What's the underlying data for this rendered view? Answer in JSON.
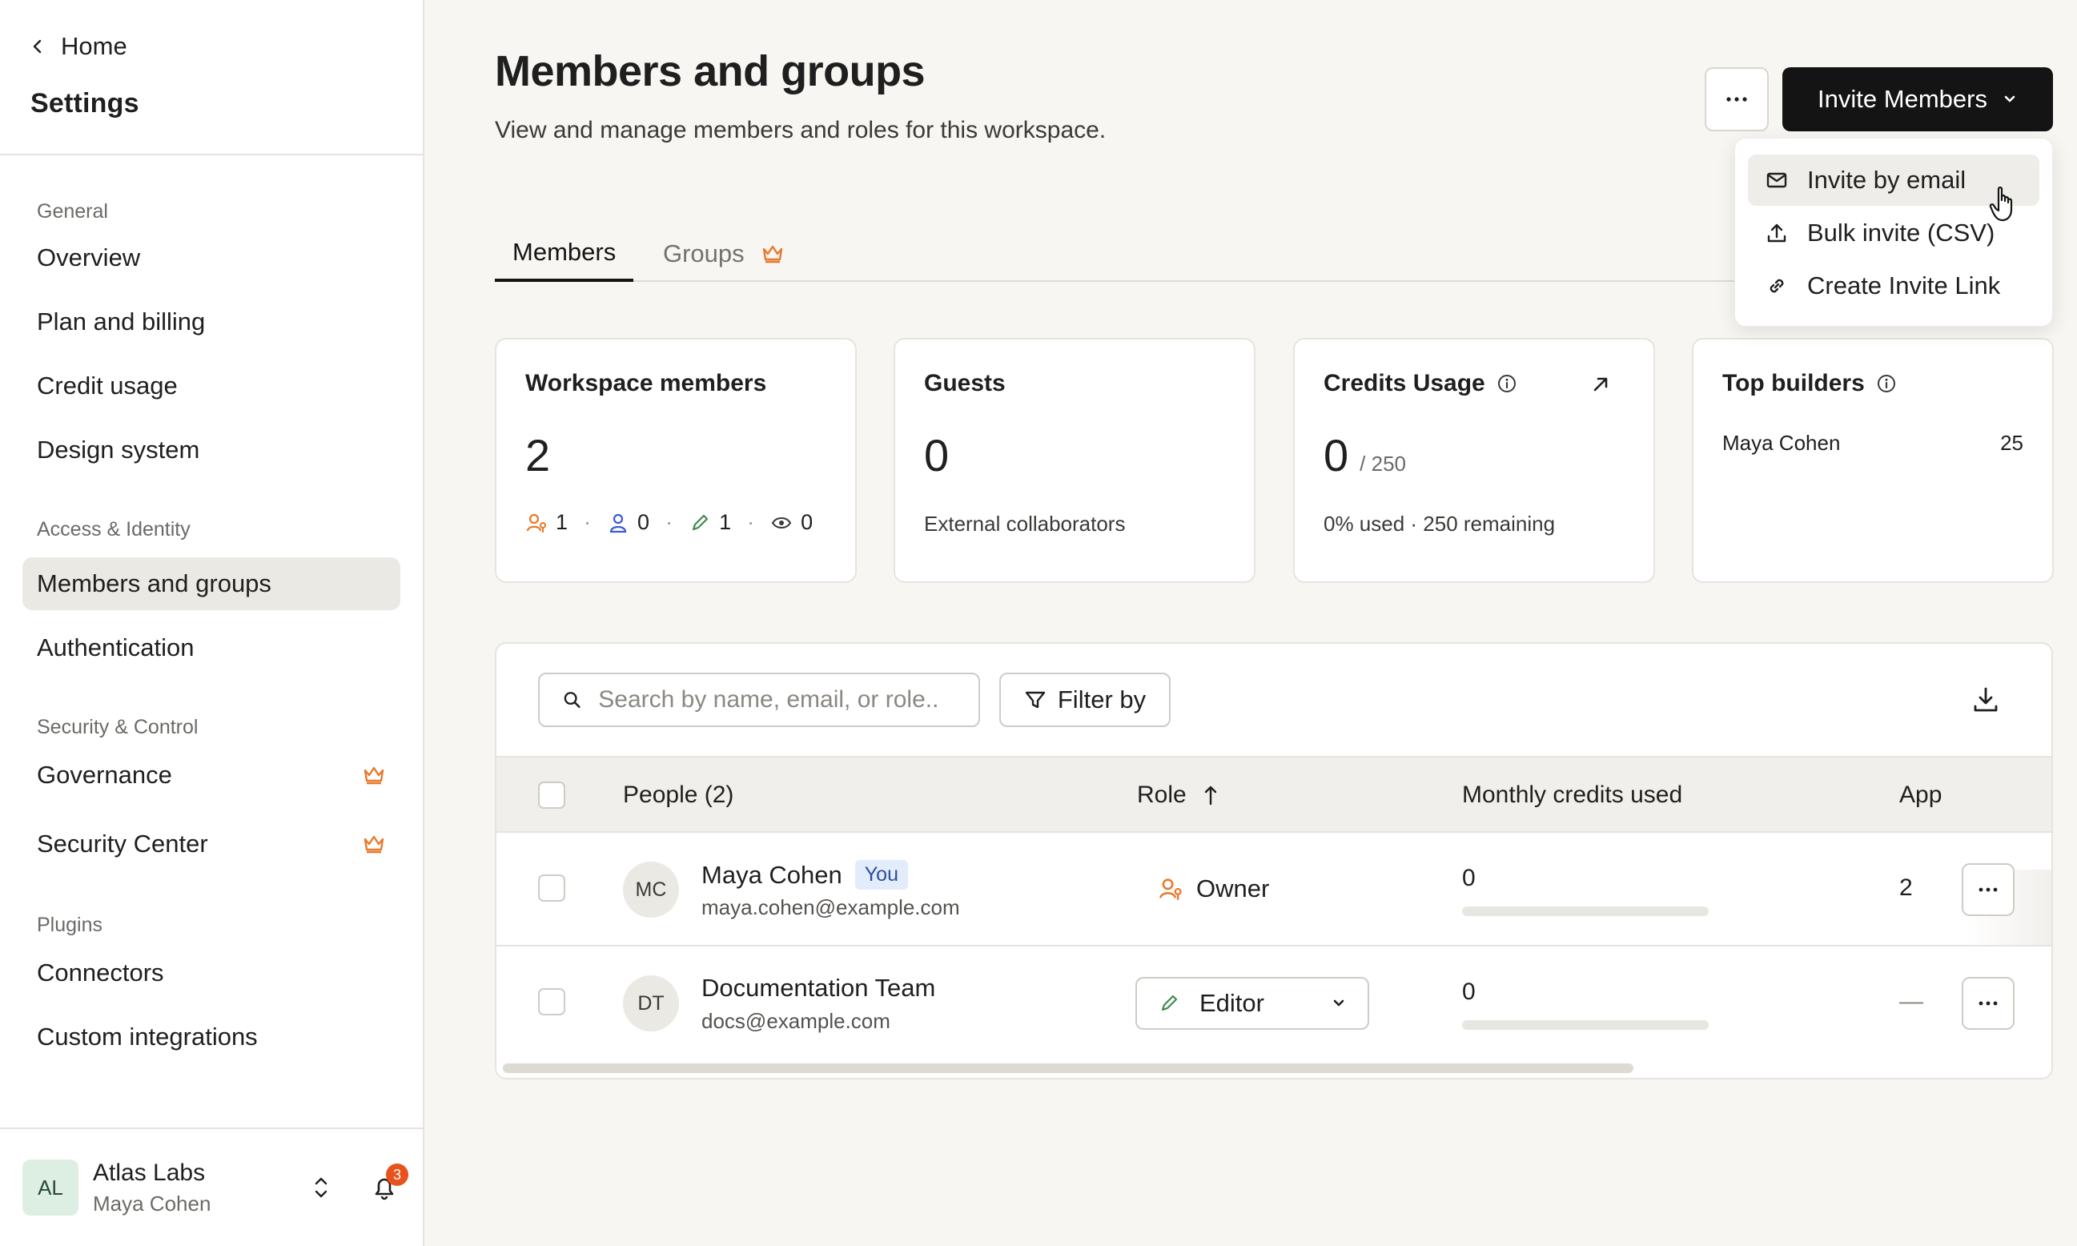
{
  "sidebar": {
    "home_label": "Home",
    "title": "Settings",
    "sections": {
      "general": "General",
      "access": "Access & Identity",
      "security": "Security & Control",
      "plugins": "Plugins"
    },
    "items": {
      "overview": "Overview",
      "plan_billing": "Plan and billing",
      "credit_usage": "Credit usage",
      "design_system": "Design system",
      "members_groups": "Members and groups",
      "authentication": "Authentication",
      "governance": "Governance",
      "security_center": "Security Center",
      "connectors": "Connectors",
      "custom_integrations": "Custom integrations"
    },
    "footer": {
      "workspace_initials": "AL",
      "workspace_name": "Atlas Labs",
      "user_name": "Maya Cohen",
      "notification_count": "3"
    }
  },
  "header": {
    "title": "Members and groups",
    "subtitle": "View and manage members and roles for this workspace.",
    "more_label": "···",
    "invite_label": "Invite Members"
  },
  "dropdown": {
    "items": [
      "Invite by email",
      "Bulk invite (CSV)",
      "Create Invite Link"
    ]
  },
  "tabs": {
    "members": "Members",
    "groups": "Groups"
  },
  "cards": {
    "members": {
      "title": "Workspace members",
      "value": "2",
      "counts": {
        "owner": "1",
        "admin": "0",
        "editor": "1",
        "viewer": "0"
      }
    },
    "guests": {
      "title": "Guests",
      "value": "0",
      "sub": "External collaborators"
    },
    "credits": {
      "title": "Credits Usage",
      "value": "0",
      "limit": "/ 250",
      "sub": "0% used · 250 remaining"
    },
    "builders": {
      "title": "Top builders",
      "rows": [
        {
          "name": "Maya Cohen",
          "value": "25"
        }
      ]
    }
  },
  "table": {
    "search_placeholder": "Search by name, email, or role..",
    "filter_label": "Filter by",
    "columns": {
      "people": "People (2)",
      "role": "Role",
      "credits": "Monthly credits used",
      "apps": "App"
    },
    "rows": [
      {
        "initials": "MC",
        "name": "Maya Cohen",
        "badge": "You",
        "email": "maya.cohen@example.com",
        "role": "Owner",
        "credits": "0",
        "apps": "2"
      },
      {
        "initials": "DT",
        "name": "Documentation Team",
        "email": "docs@example.com",
        "role": "Editor",
        "credits": "0",
        "apps": "—"
      }
    ],
    "row_more_label": "···"
  },
  "colors": {
    "owner": "#e8782a",
    "admin": "#3b5bd6",
    "editor": "#3f8a4e",
    "accent_dark": "#141414",
    "premium": "#e8782a"
  }
}
